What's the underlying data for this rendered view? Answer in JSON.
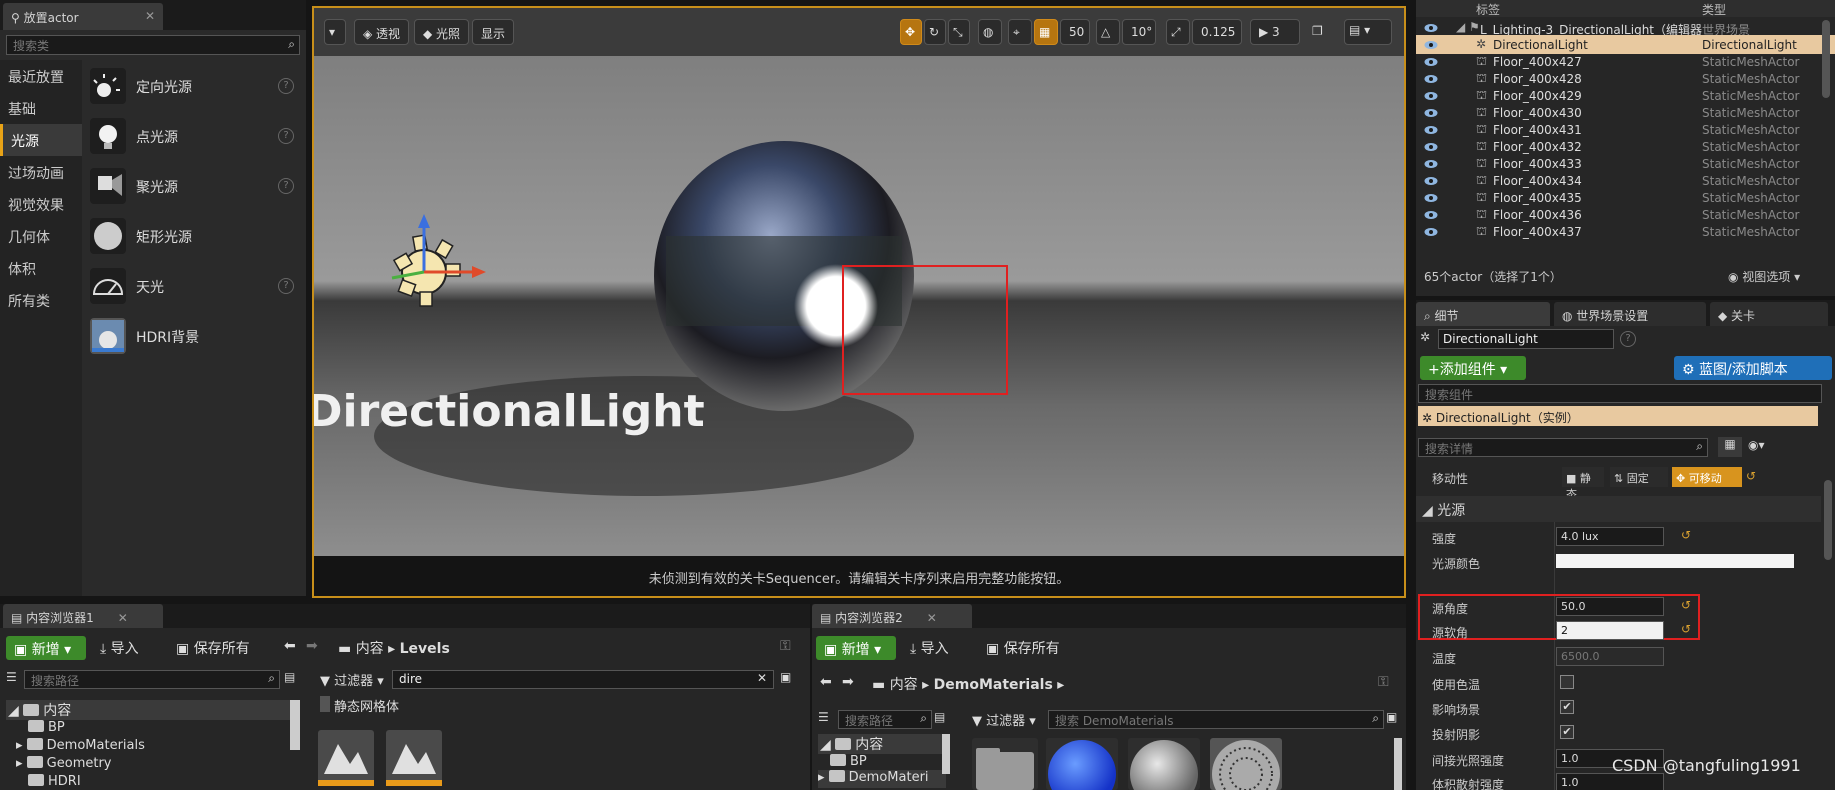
{
  "place_actor": {
    "tab_label": "放置actor",
    "search_placeholder": "搜索类",
    "categories": [
      "最近放置",
      "基础",
      "光源",
      "过场动画",
      "视觉效果",
      "几何体",
      "体积",
      "所有类"
    ],
    "items": [
      {
        "label": "定向光源",
        "icon": "directional-light-icon"
      },
      {
        "label": "点光源",
        "icon": "point-light-icon"
      },
      {
        "label": "聚光源",
        "icon": "spot-light-icon"
      },
      {
        "label": "矩形光源",
        "icon": "rect-light-icon"
      },
      {
        "label": "天光",
        "icon": "sky-light-icon"
      },
      {
        "label": "HDRI背景",
        "icon": "hdri-backdrop-icon"
      }
    ]
  },
  "viewport": {
    "buttons": [
      "透视",
      "光照",
      "显示"
    ],
    "grid_snap": "50",
    "rotation_snap": "10°",
    "scale_snap": "0.125",
    "camera_speed": "3",
    "actor_label": "DirectionalLight",
    "status": "未侦测到有效的关卡Sequencer。请编辑关卡序列来启用完整功能按钮。"
  },
  "outliner": {
    "col_label": "标签",
    "col_type": "类型",
    "rows": [
      {
        "name": "L_Lighting-3_DirectionalLight（编辑器",
        "type": "世界场景"
      },
      {
        "name": "DirectionalLight",
        "type": "DirectionalLight"
      },
      {
        "name": "Floor_400x427",
        "type": "StaticMeshActor"
      },
      {
        "name": "Floor_400x428",
        "type": "StaticMeshActor"
      },
      {
        "name": "Floor_400x429",
        "type": "StaticMeshActor"
      },
      {
        "name": "Floor_400x430",
        "type": "StaticMeshActor"
      },
      {
        "name": "Floor_400x431",
        "type": "StaticMeshActor"
      },
      {
        "name": "Floor_400x432",
        "type": "StaticMeshActor"
      },
      {
        "name": "Floor_400x433",
        "type": "StaticMeshActor"
      },
      {
        "name": "Floor_400x434",
        "type": "StaticMeshActor"
      },
      {
        "name": "Floor_400x435",
        "type": "StaticMeshActor"
      },
      {
        "name": "Floor_400x436",
        "type": "StaticMeshActor"
      },
      {
        "name": "Floor_400x437",
        "type": "StaticMeshActor"
      }
    ],
    "footer_count": "65个actor（选择了1个）",
    "view_options": "视图选项"
  },
  "details": {
    "tabs": [
      "细节",
      "世界场景设置",
      "关卡"
    ],
    "actor_name": "DirectionalLight",
    "add_component": "+添加组件",
    "blueprint_button": "蓝图/添加脚本",
    "search_components": "搜索组件",
    "component_instance": "DirectionalLight（实例）",
    "search_details": "搜索详情",
    "mobility_label": "移动性",
    "mobility_options": [
      "静态",
      "固定",
      "可移动"
    ],
    "section_light": "光源",
    "props": [
      {
        "label": "强度",
        "value": "4.0 lux"
      },
      {
        "label": "光源颜色",
        "value": ""
      },
      {
        "label": "源角度",
        "value": "50.0"
      },
      {
        "label": "源软角",
        "value": "2"
      },
      {
        "label": "温度",
        "value": "6500.0"
      },
      {
        "label": "使用色温",
        "value": ""
      },
      {
        "label": "影响场景",
        "value": "✔"
      },
      {
        "label": "投射阴影",
        "value": "✔"
      },
      {
        "label": "间接光照强度",
        "value": "1.0"
      },
      {
        "label": "体积散射强度",
        "value": "1.0"
      }
    ]
  },
  "cb1": {
    "tab": "内容浏览器1",
    "new": "新增",
    "import": "导入",
    "save_all": "保存所有",
    "path": [
      "内容",
      "Levels"
    ],
    "search_path": "搜索路径",
    "filter": "过滤器",
    "filter_text": "dire",
    "filter_chip": "静态网格体",
    "tree": [
      "内容",
      "BP",
      "DemoMaterials",
      "Geometry",
      "HDRI"
    ]
  },
  "cb2": {
    "tab": "内容浏览器2",
    "new": "新增",
    "import": "导入",
    "save_all": "保存所有",
    "path": [
      "内容",
      "DemoMaterials"
    ],
    "search_path": "搜索路径",
    "filter": "过滤器",
    "search_assets": "搜索 DemoMaterials",
    "tree": [
      "内容",
      "BP",
      "DemoMateri"
    ]
  },
  "watermark": "CSDN @tangfuling1991",
  "colors": {
    "accent": "#e8a317",
    "selection": "#e8c9a0",
    "highlight_box": "#e02020",
    "green_button": "#3d8a2a",
    "blue_button": "#1f6fb8"
  }
}
